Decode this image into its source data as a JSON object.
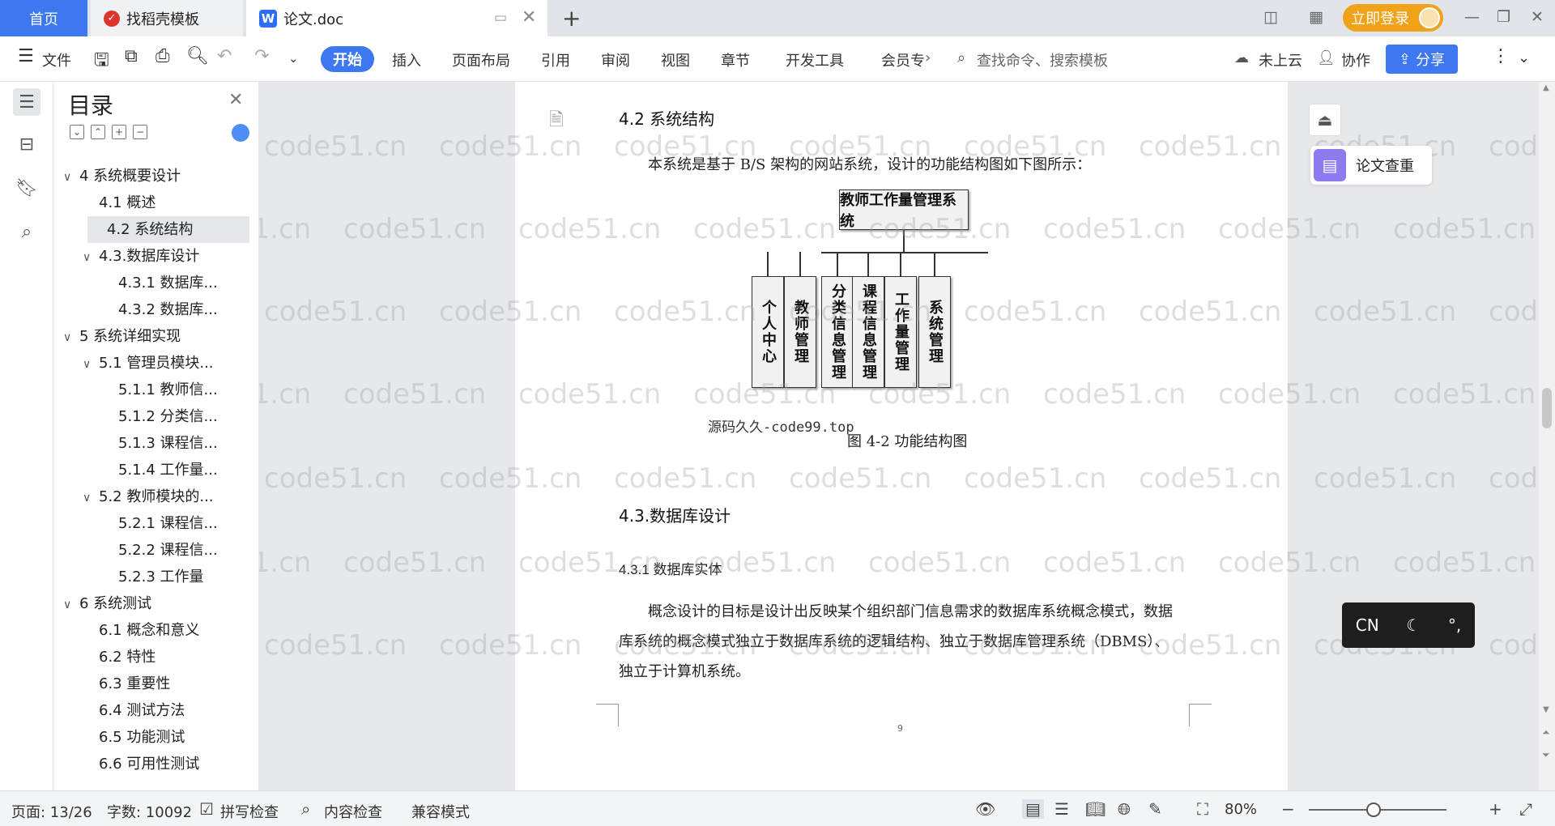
{
  "titlebar": {
    "tab_home": "首页",
    "tab_templates": "找稻壳模板",
    "tab_document": "论文.doc",
    "new_tab": "+",
    "login": "立即登录"
  },
  "toolbar": {
    "file": "文件",
    "start": "开始",
    "menu": [
      "插入",
      "页面布局",
      "引用",
      "审阅",
      "视图",
      "章节",
      "开发工具",
      "会员专"
    ],
    "search_placeholder": "查找命令、搜索模板",
    "cloud": "未上云",
    "collab": "协作",
    "share": "分享"
  },
  "toc": {
    "title": "目录",
    "items": [
      {
        "label": "4 系统概要设计",
        "level": 1,
        "caret": "∨"
      },
      {
        "label": "4.1 概述",
        "level": 2
      },
      {
        "label": "4.2 系统结构",
        "level": 2,
        "active": true
      },
      {
        "label": "4.3.数据库设计",
        "level": 2,
        "caret": "∨"
      },
      {
        "label": "4.3.1 数据库...",
        "level": 3
      },
      {
        "label": "4.3.2 数据库...",
        "level": 3
      },
      {
        "label": "5 系统详细实现",
        "level": 1,
        "caret": "∨"
      },
      {
        "label": "5.1  管理员模块...",
        "level": 2,
        "caret": "∨"
      },
      {
        "label": "5.1.1  教师信...",
        "level": 3
      },
      {
        "label": "5.1.2  分类信...",
        "level": 3
      },
      {
        "label": "5.1.3  课程信...",
        "level": 3
      },
      {
        "label": "5.1.4  工作量...",
        "level": 3
      },
      {
        "label": "5.2  教师模块的...",
        "level": 2,
        "caret": "∨"
      },
      {
        "label": "5.2.1  课程信...",
        "level": 3
      },
      {
        "label": "5.2.2  课程信...",
        "level": 3
      },
      {
        "label": "5.2.3  工作量",
        "level": 3
      },
      {
        "label": "6 系统测试",
        "level": 1,
        "caret": "∨"
      },
      {
        "label": "6.1 概念和意义",
        "level": 2
      },
      {
        "label": "6.2 特性",
        "level": 2
      },
      {
        "label": "6.3 重要性",
        "level": 2
      },
      {
        "label": "6.4 测试方法",
        "level": 2
      },
      {
        "label": "6.5  功能测试",
        "level": 2
      },
      {
        "label": "6.6 可用性测试",
        "level": 2
      }
    ]
  },
  "document": {
    "heading_42": "4.2 系统结构",
    "para_intro": "本系统是基于 B/S 架构的网站系统，设计的功能结构图如下图所示：",
    "diagram_root": "教师工作量管理系统",
    "diagram_children": [
      "个人中心",
      "教师管理",
      "分类信息管理",
      "课程信息管理",
      "工作量管理",
      "系统管理"
    ],
    "source_note": "源码久久-code99.top",
    "figure_caption": "图 4-2 功能结构图",
    "heading_43": "4.3.数据库设计",
    "heading_431": "4.3.1 数据库实体",
    "para_1": "概念设计的目标是设计出反映某个组织部门信息需求的数据库系统概念模式，数据",
    "para_2": "库系统的概念模式独立于数据库系统的逻辑结构、独立于数据库管理系统（DBMS）、",
    "para_3": "独立于计算机系统。",
    "page_number": "9"
  },
  "watermark": "code51.cn",
  "right_panel": {
    "check_label": "论文查重"
  },
  "ime": {
    "lang": "CN",
    "moon": "☾",
    "punct": "°,"
  },
  "statusbar": {
    "page": "页面: 13/26",
    "words": "字数: 10092",
    "spell": "拼写检查",
    "content": "内容检查",
    "compat": "兼容模式",
    "zoom": "80%"
  },
  "colors": {
    "accent": "#3e78f0",
    "login": "#f0a21b",
    "purple": "#8c7cf0"
  }
}
